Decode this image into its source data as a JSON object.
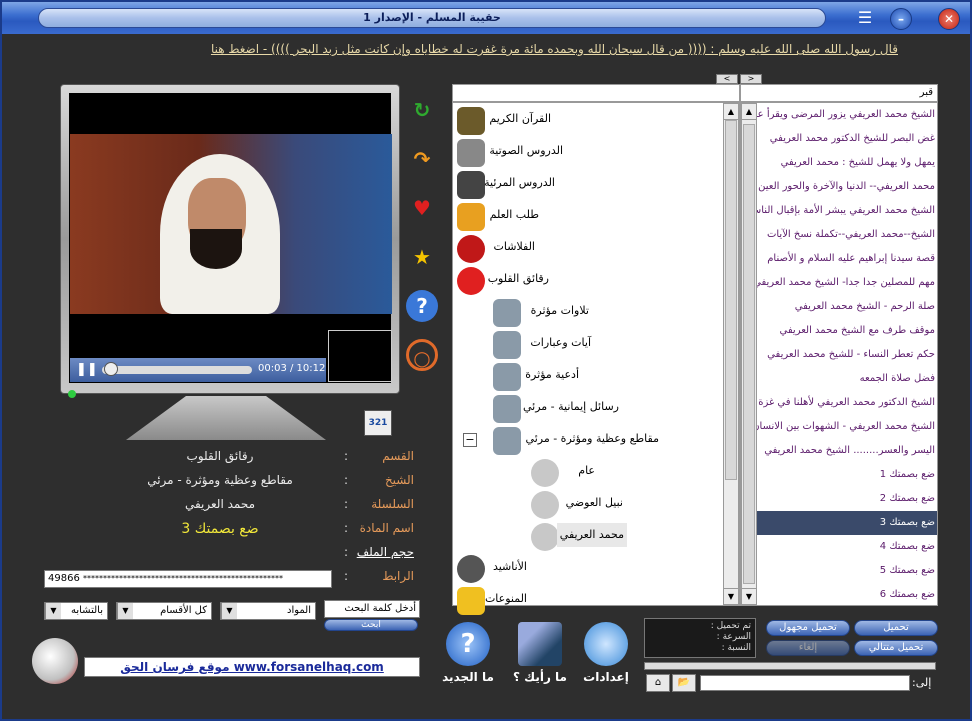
{
  "window": {
    "title": "حقيبة المسلم - الإصدار 1"
  },
  "marquee": {
    "text": "قال رسول الله صلى الله عليه وسلم : (((( من قال سبحان الله وبحمده مائة مرة غفرت له خطاياه وإن كانت مثل زبد البحر )))) - اضغط هنا"
  },
  "player": {
    "time": "00:03 / 10:12"
  },
  "info": {
    "rows": [
      {
        "label": "القسم",
        "value": "رقائق القلوب"
      },
      {
        "label": "الشيخ",
        "value": "مقاطع وعظية ومؤثرة - مرئي"
      },
      {
        "label": "السلسلة",
        "value": "محمد العريفي"
      },
      {
        "label": "اسم المادة",
        "value": "ضع بصمتك 3"
      },
      {
        "label": "حجم الملف",
        "value": ""
      },
      {
        "label": "الرابط",
        "value": ""
      }
    ]
  },
  "link": {
    "id": "49866",
    "masked": "**************************************************"
  },
  "search": {
    "placeholder": "أدخل كلمة البحث",
    "button": "ابحث",
    "combo1": "بالتشابه",
    "combo2": "كل الأقسام",
    "combo3": "المواد"
  },
  "tree": {
    "items": [
      "القرآن الكريم",
      "الدروس الصوتية",
      "الدروس المرئية",
      "طلب العلم",
      "الفلاشات",
      "رقائق القلوب",
      "تلاوات مؤثرة",
      "آيات وعبارات",
      "أدعية مؤثرة",
      "رسائل إيمانية - مرئي",
      "مقاطع وعظية ومؤثرة - مرئي",
      "عام",
      "نبيل العوضي",
      "محمد العريفي",
      "الأناشيد",
      "المنوعات"
    ]
  },
  "list": {
    "header": "قبر",
    "items": [
      "الشيخ محمد العريفي يزور المرضى ويقرأ عليهم",
      "غض البصر للشيخ الدكتور محمد العريفي",
      "يمهل ولا يهمل للشيخ : محمد العريفي",
      "محمد العريفي-- الدنيا والآخرة والحور العين",
      "الشيخ محمد العريفي يبشر الأمة بإقبال الناس على",
      "الشيخ--محمد العريفي--تكملة نسخ الآيات",
      "قصة سيدنا إبراهيم عليه السلام و الأصنام",
      "مهم للمصلين جدا جدا- الشيخ محمد العريفي",
      "صلة الرحم - الشيخ محمد العريفي",
      "موقف طرف مع الشيخ محمد العريفي",
      "حكم تعطر النساء - للشيخ محمد العريفي",
      "فضل صلاة الجمعه",
      "الشيخ الدكتور محمد العريفي لأهلنا في غزة",
      "الشيخ محمد العريفي - الشهوات بين الانسان",
      "اليسر والعسر........ الشيخ محمد العريفي",
      "ضع بصمتك 1",
      "ضع بصمتك 2",
      "ضع بصمتك 3",
      "ضع بصمتك 4",
      "ضع بصمتك 5",
      "ضع بصمتك 6"
    ]
  },
  "downloads": {
    "download": "تحميل",
    "download_unknown": "تحميل مجهول",
    "download_seq": "تحميل متتالي",
    "cancel": "إلغاء",
    "status": [
      "تم تحميل :",
      "السرعة :",
      "النسبة :"
    ],
    "to_label": "إلى:"
  },
  "bottom": {
    "settings": "إعدادات",
    "opinion": "ما رأيك ؟",
    "whats_new": "ما الجديد",
    "site": "موقع فرسان الحق www.forsanelhaq.com"
  }
}
